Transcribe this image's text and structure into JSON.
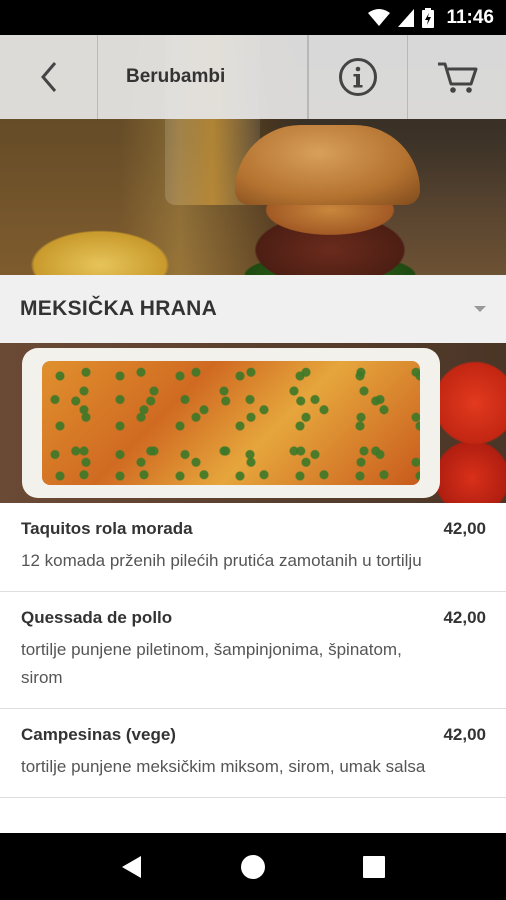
{
  "status_bar": {
    "time": "11:46",
    "icons": [
      "wifi-icon",
      "cellular-signal-icon",
      "battery-charging-icon"
    ]
  },
  "toolbar": {
    "title": "Berubambi",
    "icons": [
      "back-arrow-icon",
      "info-icon",
      "cart-icon"
    ]
  },
  "category": {
    "title": "MEKSIČKA HRANA",
    "icon": "dropdown-arrow-icon"
  },
  "menu_items": [
    {
      "name": "Taquitos rola morada",
      "price": "42,00",
      "description": "12 komada prženih pilećih prutića zamotanih u tortilju"
    },
    {
      "name": "Quessada de pollo",
      "price": "42,00",
      "description": "tortilje punjene piletinom, šampinjonima, špinatom, sirom"
    },
    {
      "name": "Campesinas (vege)",
      "price": "42,00",
      "description": "tortilje punjene meksičkim miksom, sirom, umak salsa"
    }
  ],
  "nav_bar": {
    "icons": [
      "back-triangle-icon",
      "home-circle-icon",
      "recents-square-icon"
    ]
  },
  "colors": {
    "toolbar_bg": "#e6e6e6",
    "category_bg": "#f0f0f0",
    "text_primary": "#333333",
    "text_secondary": "#555555"
  }
}
